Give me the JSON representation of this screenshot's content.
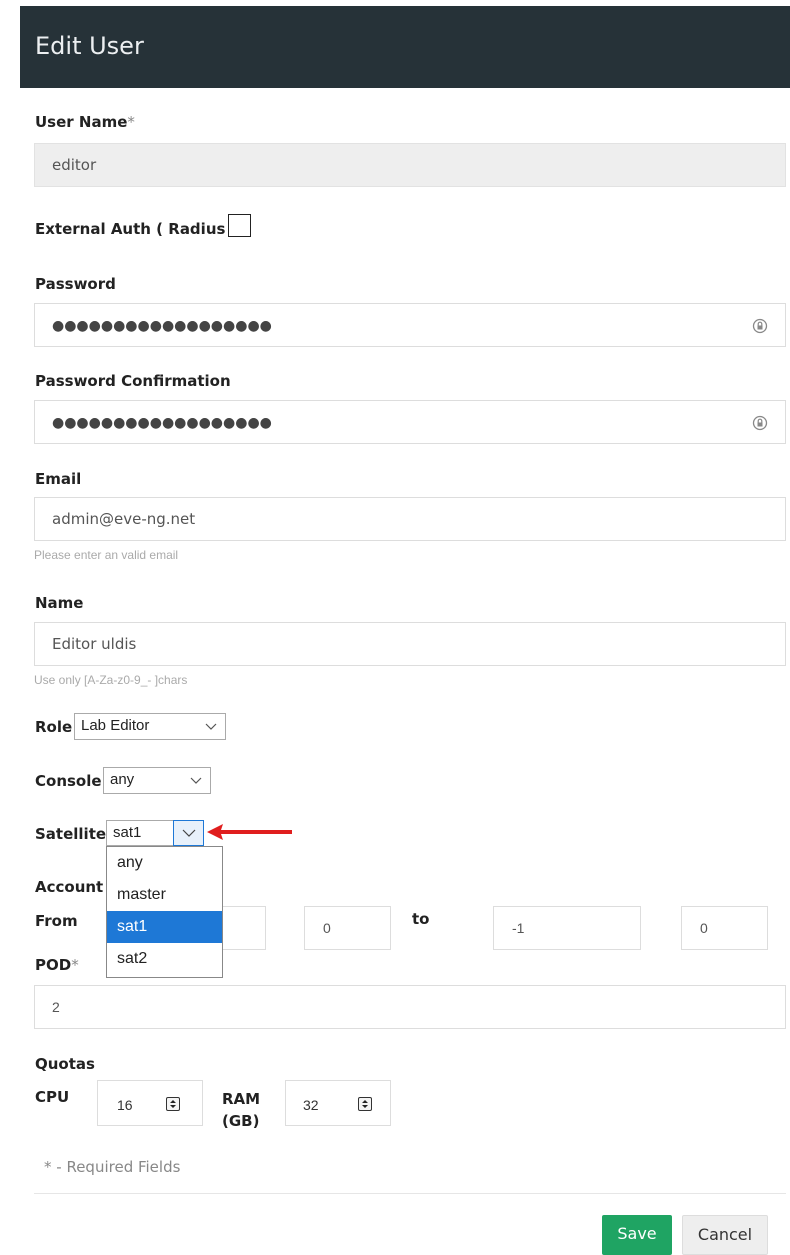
{
  "header": {
    "title": "Edit User"
  },
  "form": {
    "username": {
      "label": "User Name",
      "required_mark": "*",
      "value": "editor"
    },
    "external_auth": {
      "label": "External Auth ( Radius )",
      "checked": false
    },
    "password": {
      "label": "Password",
      "value": "●●●●●●●●●●●●●●●●●●"
    },
    "password_confirm": {
      "label": "Password Confirmation",
      "value": "●●●●●●●●●●●●●●●●●●"
    },
    "email": {
      "label": "Email",
      "value": "admin@eve-ng.net",
      "help": "Please enter an valid email"
    },
    "name": {
      "label": "Name",
      "value": "Editor uldis",
      "help": "Use only [A-Za-z0-9_- ]chars"
    },
    "role": {
      "label": "Role",
      "value": "Lab Editor"
    },
    "console": {
      "label": "Console",
      "value": "any"
    },
    "satellite": {
      "label": "Satellite",
      "value": "sat1",
      "options": [
        "any",
        "master",
        "sat1",
        "sat2"
      ],
      "selected_index": 2
    },
    "account_validity": {
      "label": "Account V",
      "from_label": "From",
      "to_label": "to",
      "from_time_value": "0",
      "to_date_value": "-1",
      "to_time_value": "0"
    },
    "pod": {
      "label": "POD",
      "required_mark": "*",
      "value": "2"
    },
    "quotas": {
      "label": "Quotas",
      "cpu_label": "CPU",
      "cpu_value": "16",
      "ram_label_1": "RAM",
      "ram_label_2": "(GB)",
      "ram_value": "32"
    },
    "required_note": "* - Required Fields"
  },
  "buttons": {
    "save": "Save",
    "cancel": "Cancel"
  },
  "colors": {
    "header_bg": "#263238",
    "save_bg": "#1fa463",
    "dropdown_active": "#1e78d6",
    "arrow": "#e01e1e"
  }
}
